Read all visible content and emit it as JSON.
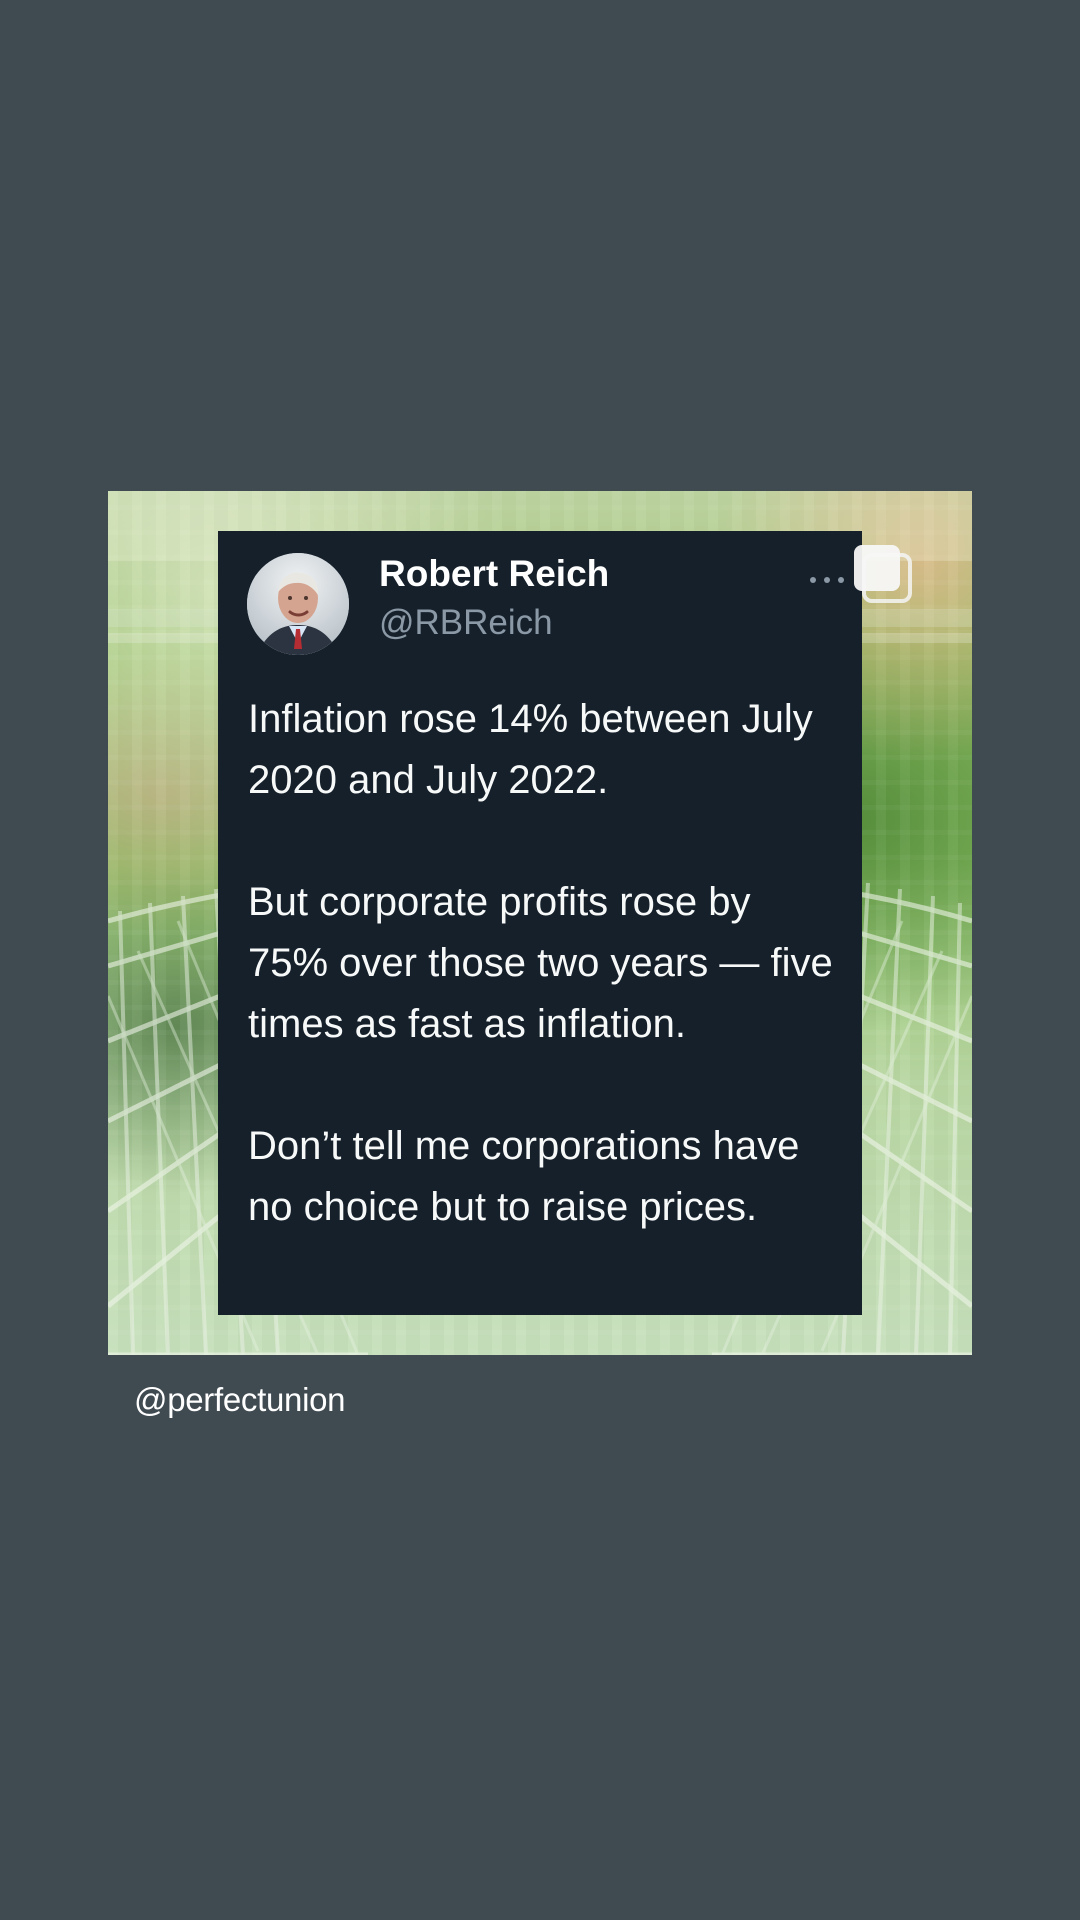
{
  "post": {
    "author_name": "Robert Reich",
    "author_handle": "@RBReich",
    "paragraphs": [
      "Inflation rose 14% between July 2020 and July 2022.",
      "But corporate profits rose by 75% over those two years — five times as fast as inflation.",
      "Don’t tell me corporations have no choice but to raise prices."
    ],
    "icons": {
      "avatar": "profile-photo",
      "more": "more-options-icon",
      "carousel": "multiple-images-icon"
    }
  },
  "footer": {
    "account": "@perfectunion"
  },
  "colors": {
    "page_background": "#3f4a51",
    "tweet_background": "#15202b",
    "tweet_text": "#f7f9f9",
    "handle_text": "#8b98a5"
  }
}
